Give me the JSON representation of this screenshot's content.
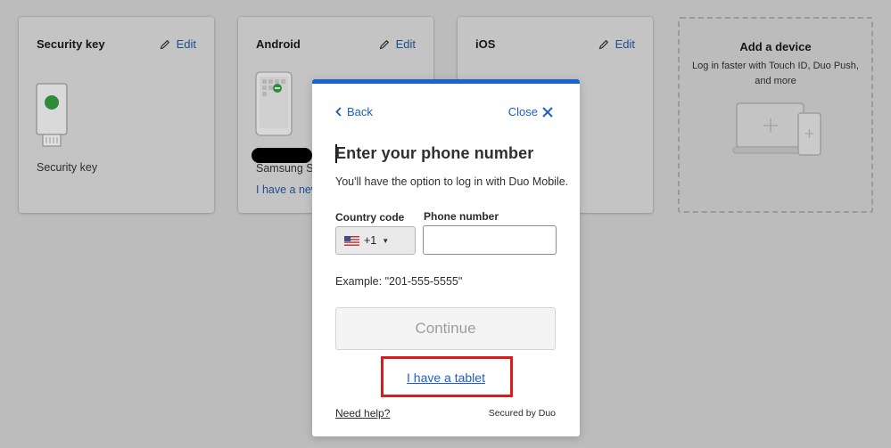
{
  "cards": [
    {
      "title": "Security key",
      "edit_label": "Edit",
      "caption": "Security key"
    },
    {
      "title": "Android",
      "edit_label": "Edit",
      "caption": "Samsung Sl",
      "link": "I have a new"
    },
    {
      "title": "iOS",
      "edit_label": "Edit"
    }
  ],
  "add_device": {
    "title": "Add a device",
    "subtitle": "Log in faster with Touch ID, Duo Push, and more"
  },
  "modal": {
    "back_label": "Back",
    "close_label": "Close",
    "title": "Enter your phone number",
    "description": "You'll have the option to log in with Duo Mobile.",
    "country_code_label": "Country code",
    "country_code_value": "+1",
    "phone_number_label": "Phone number",
    "phone_number_value": "",
    "example": "Example: \"201-555-5555\"",
    "continue_label": "Continue",
    "tablet_link": "I have a tablet",
    "help_link": "Need help?",
    "secured_by": "Secured by Duo"
  },
  "colors": {
    "accent": "#1a62d4",
    "link": "#1d5fc4",
    "highlight": "#dc1c1c",
    "overlay": "#bcbcbc",
    "security_key_led": "#2e8b3a"
  },
  "icons": [
    "pencil-icon",
    "security-key-icon",
    "android-phone-icon",
    "laptop-tablet-icon",
    "chevron-left-icon",
    "close-icon",
    "us-flag-icon",
    "caret-down-icon"
  ]
}
